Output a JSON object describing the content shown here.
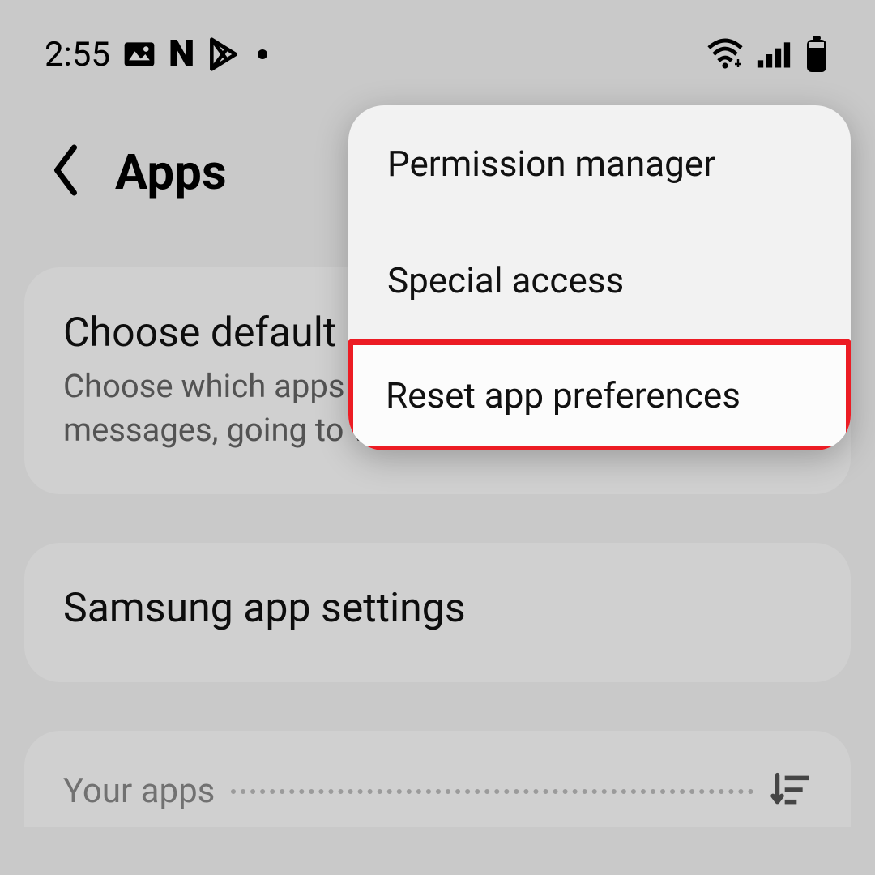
{
  "status": {
    "time": "2:55"
  },
  "header": {
    "title": "Apps"
  },
  "cards": {
    "choose_default": {
      "title": "Choose default apps",
      "subtitle": "Choose which apps to use for making calls, sending messages, going to websites, and more."
    },
    "samsung_settings": {
      "title": "Samsung app settings"
    }
  },
  "section": {
    "your_apps": "Your apps"
  },
  "popup": {
    "items": [
      {
        "label": "Permission manager",
        "highlighted": false
      },
      {
        "label": "Special access",
        "highlighted": false
      },
      {
        "label": "Reset app preferences",
        "highlighted": true
      }
    ]
  },
  "annotation": {
    "highlight_color": "#ec1c24"
  }
}
